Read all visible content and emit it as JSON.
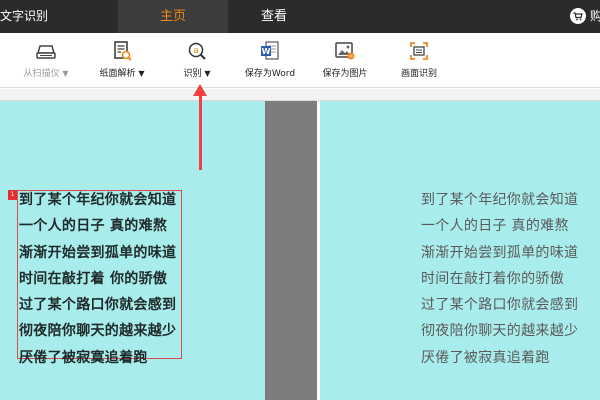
{
  "app": {
    "title": "文字识别"
  },
  "tabs": [
    {
      "label": "主页",
      "active": true
    },
    {
      "label": "查看",
      "active": false
    }
  ],
  "header": {
    "cart_label": "购"
  },
  "toolbar": {
    "items": [
      {
        "label": "从扫描仪",
        "caret": "▼",
        "icon": "scanner-icon",
        "enabled": false
      },
      {
        "label": "纸面解析",
        "caret": "▼",
        "icon": "page-analysis-icon",
        "enabled": true
      },
      {
        "label": "识别",
        "caret": "▼",
        "icon": "recognize-icon",
        "enabled": true
      },
      {
        "label": "保存为Word",
        "caret": "",
        "icon": "word-icon",
        "enabled": true
      },
      {
        "label": "保存为图片",
        "caret": "",
        "icon": "image-icon",
        "enabled": true
      },
      {
        "label": "画面识别",
        "caret": "",
        "icon": "screen-capture-icon",
        "enabled": true
      }
    ]
  },
  "source_text": [
    "到了某个年纪你就会知道",
    "一个人的日子 真的难熬",
    "渐渐开始尝到孤单的味道",
    "时间在敲打着 你的骄傲",
    "过了某个路口你就会感到",
    "彻夜陪你聊天的越来越少",
    "厌倦了被寂寞追着跑"
  ],
  "selection_tag": "1",
  "ocr_text": [
    "到了某个年纪你就会知道",
    "一个人的日子  真的难熬",
    "渐渐开始尝到孤单的味道",
    "时间在敲打着你的骄傲",
    "过了某个路口你就会感到",
    "彻夜陪你聊天的越来越少",
    "厌倦了被寂真追着跑"
  ],
  "colors": {
    "accent": "#f08a1c",
    "panel": "#a9ecec",
    "titlebar": "#2b2b2b",
    "arrow": "#f04040"
  }
}
